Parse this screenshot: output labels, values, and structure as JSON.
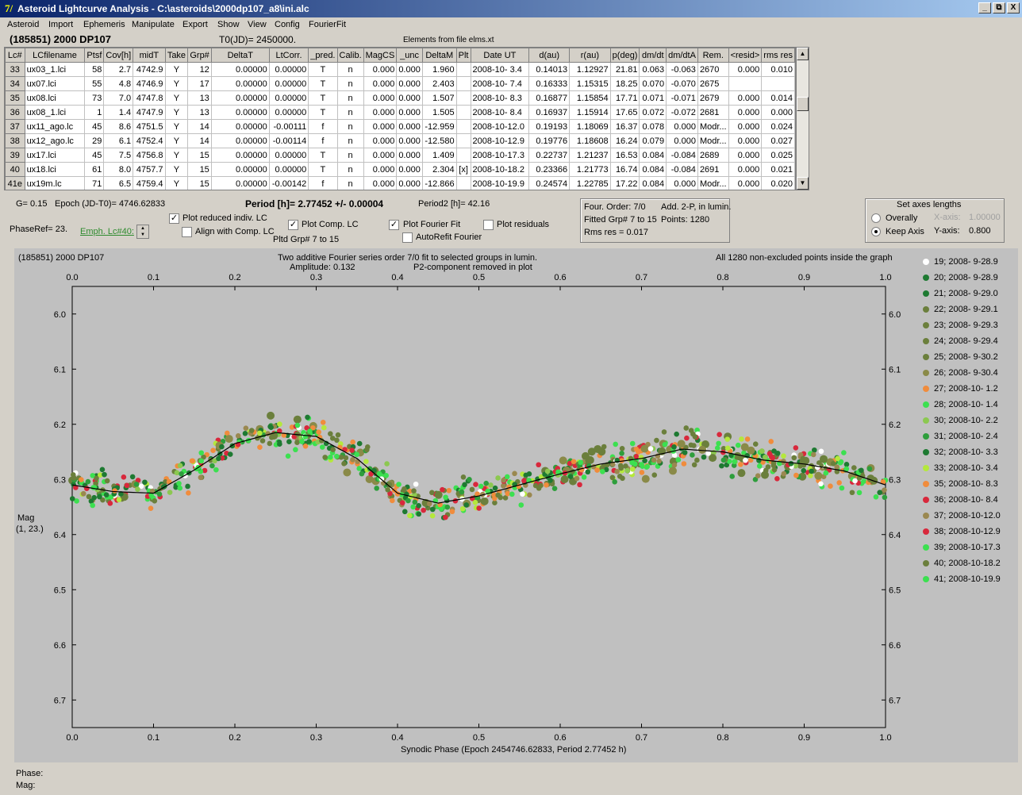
{
  "window": {
    "title": "Asteroid Lightcurve Analysis - C:\\asteroids\\2000dp107_a8\\ini.alc",
    "buttons": [
      "_",
      "⧉",
      "X"
    ]
  },
  "menu": [
    "Asteroid",
    "Import",
    "Ephemeris",
    "Manipulate",
    "Export",
    "Show",
    "View",
    "Config",
    "FourierFit"
  ],
  "header": {
    "object": "(185851) 2000 DP107",
    "t0": "T0(JD)= 2450000.",
    "elements": "Elements from file elms.xt"
  },
  "grid": {
    "columns": [
      "Lc#",
      "LCfilename",
      "Ptsf",
      "Cov[h]",
      "midT",
      "Take",
      "Grp#",
      "DeltaT",
      "LtCorr.",
      "_pred.",
      "Calib.",
      "MagCS",
      "_unc",
      "DeltaM",
      "Plt",
      "Date UT",
      "d(au)",
      "r(au)",
      "p(deg)",
      "dm/dt",
      "dm/dtA",
      "Rem.",
      "<resid>",
      "rms res"
    ],
    "rows": [
      [
        "33",
        "ux03_1.lci",
        "58",
        "2.7",
        "4742.9",
        "Y",
        "12",
        "0.00000",
        "0.00000",
        "T",
        "n",
        "0.000",
        "0.000",
        "1.960",
        "",
        "2008-10- 3.4",
        "0.14013",
        "1.12927",
        "21.81",
        "0.063",
        "-0.063",
        "2670",
        "0.000",
        "0.010"
      ],
      [
        "34",
        "ux07.lci",
        "55",
        "4.8",
        "4746.9",
        "Y",
        "17",
        "0.00000",
        "0.00000",
        "T",
        "n",
        "0.000",
        "0.000",
        "2.403",
        "",
        "2008-10- 7.4",
        "0.16333",
        "1.15315",
        "18.25",
        "0.070",
        "-0.070",
        "2675",
        "",
        ""
      ],
      [
        "35",
        "ux08.lci",
        "73",
        "7.0",
        "4747.8",
        "Y",
        "13",
        "0.00000",
        "0.00000",
        "T",
        "n",
        "0.000",
        "0.000",
        "1.507",
        "",
        "2008-10- 8.3",
        "0.16877",
        "1.15854",
        "17.71",
        "0.071",
        "-0.071",
        "2679",
        "0.000",
        "0.014"
      ],
      [
        "36",
        "ux08_1.lci",
        "1",
        "1.4",
        "4747.9",
        "Y",
        "13",
        "0.00000",
        "0.00000",
        "T",
        "n",
        "0.000",
        "0.000",
        "1.505",
        "",
        "2008-10- 8.4",
        "0.16937",
        "1.15914",
        "17.65",
        "0.072",
        "-0.072",
        "2681",
        "0.000",
        "0.000"
      ],
      [
        "37",
        "ux11_ago.lc",
        "45",
        "8.6",
        "4751.5",
        "Y",
        "14",
        "0.00000",
        "-0.00111",
        "f",
        "n",
        "0.000",
        "0.000",
        "-12.959",
        "",
        "2008-10-12.0",
        "0.19193",
        "1.18069",
        "16.37",
        "0.078",
        "0.000",
        "Modr...",
        "0.000",
        "0.024"
      ],
      [
        "38",
        "ux12_ago.lc",
        "29",
        "6.1",
        "4752.4",
        "Y",
        "14",
        "0.00000",
        "-0.00114",
        "f",
        "n",
        "0.000",
        "0.000",
        "-12.580",
        "",
        "2008-10-12.9",
        "0.19776",
        "1.18608",
        "16.24",
        "0.079",
        "0.000",
        "Modr...",
        "0.000",
        "0.027"
      ],
      [
        "39",
        "ux17.lci",
        "45",
        "7.5",
        "4756.8",
        "Y",
        "15",
        "0.00000",
        "0.00000",
        "T",
        "n",
        "0.000",
        "0.000",
        "1.409",
        "",
        "2008-10-17.3",
        "0.22737",
        "1.21237",
        "16.53",
        "0.084",
        "-0.084",
        "2689",
        "0.000",
        "0.025"
      ],
      [
        "40",
        "ux18.lci",
        "61",
        "8.0",
        "4757.7",
        "Y",
        "15",
        "0.00000",
        "0.00000",
        "T",
        "n",
        "0.000",
        "0.000",
        "2.304",
        "[x]",
        "2008-10-18.2",
        "0.23366",
        "1.21773",
        "16.74",
        "0.084",
        "-0.084",
        "2691",
        "0.000",
        "0.021"
      ],
      [
        "41e",
        "ux19m.lc",
        "71",
        "6.5",
        "4759.4",
        "Y",
        "15",
        "0.00000",
        "-0.00142",
        "f",
        "n",
        "0.000",
        "0.000",
        "-12.866",
        "",
        "2008-10-19.9",
        "0.24574",
        "1.22785",
        "17.22",
        "0.084",
        "0.000",
        "Modr...",
        "0.000",
        "0.020"
      ]
    ]
  },
  "controls": {
    "g": "G= 0.15",
    "epoch": "Epoch (JD-T0)= 4746.62833",
    "period": "Period [h]= 2.77452 +/- 0.00004",
    "period2": "Period2 [h]= 42.16",
    "phaseref": "PhaseRef= 23.",
    "emph": "Emph. Lc#40:",
    "plot_reduced": "Plot reduced indiv. LC",
    "align_comp": "Align with Comp. LC",
    "plot_comp": "Plot Comp. LC",
    "pltd_grp": "Pltd Grp#  7  to  15",
    "plot_fourier": "Plot Fourier Fit",
    "autorefit": "AutoRefit Fourier",
    "plot_resid": "Plot residuals",
    "four_order": "Four. Order:  7/0",
    "add2p": "Add. 2-P, in lumin.",
    "fitted": "Fitted Grp# 7 to 15",
    "points": "Points: 1280",
    "rms": "Rms res     = 0.017",
    "axes_title": "Set axes lengths",
    "overally": "Overally",
    "keep_axis": "Keep Axis",
    "xaxis_lbl": "X-axis:",
    "xaxis_val": "1.00000",
    "yaxis_lbl": "Y-axis:",
    "yaxis_val": "0.800"
  },
  "plot": {
    "object": "(185851) 2000 DP107",
    "caption1": "Two additive Fourier series order 7/0 fit to selected groups in lumin.",
    "caption2a": "Amplitude: 0.132",
    "caption2b": "P2-component removed in plot",
    "caption3": "All 1280 non-excluded points inside the graph",
    "ylabel1": "Mag",
    "ylabel2": "(1, 23.)",
    "xlabel": "Synodic Phase (Epoch 2454746.62833, Period 2.77452 h)",
    "phase_lbl": "Phase:",
    "mag_lbl": "Mag:"
  },
  "chart_data": {
    "type": "scatter",
    "xlabel": "Synodic Phase (Epoch 2454746.62833, Period 2.77452 h)",
    "ylabel": "Mag",
    "xlim": [
      0.0,
      1.0
    ],
    "ylim": [
      6.75,
      5.95
    ],
    "x_ticks": [
      "0.0",
      "0.1",
      "0.2",
      "0.3",
      "0.4",
      "0.5",
      "0.6",
      "0.7",
      "0.8",
      "0.9",
      "1.0"
    ],
    "y_ticks": [
      "6.0",
      "6.1",
      "6.2",
      "6.3",
      "6.4",
      "6.5",
      "6.6",
      "6.7"
    ],
    "fourier_fit": {
      "x": [
        0.0,
        0.05,
        0.1,
        0.15,
        0.2,
        0.25,
        0.3,
        0.35,
        0.4,
        0.45,
        0.5,
        0.55,
        0.6,
        0.65,
        0.7,
        0.75,
        0.8,
        0.85,
        0.9,
        0.95,
        1.0
      ],
      "y": [
        6.31,
        6.322,
        6.325,
        6.283,
        6.235,
        6.215,
        6.222,
        6.262,
        6.325,
        6.343,
        6.33,
        6.31,
        6.29,
        6.272,
        6.262,
        6.245,
        6.25,
        6.265,
        6.272,
        6.285,
        6.31
      ]
    },
    "series": [
      {
        "name": "19; 2008- 9-28.9",
        "color": "#ffffff"
      },
      {
        "name": "20; 2008- 9-28.9",
        "color": "#1e7a32"
      },
      {
        "name": "21; 2008- 9-29.0",
        "color": "#1e7a32"
      },
      {
        "name": "22; 2008- 9-29.1",
        "color": "#6b7f3c"
      },
      {
        "name": "23; 2008- 9-29.3",
        "color": "#6b7f3c"
      },
      {
        "name": "24; 2008- 9-29.4",
        "color": "#6b7f3c"
      },
      {
        "name": "25; 2008- 9-30.2",
        "color": "#6b7f3c"
      },
      {
        "name": "26; 2008- 9-30.4",
        "color": "#8a8a48"
      },
      {
        "name": "27; 2008-10- 1.2",
        "color": "#f08c3c"
      },
      {
        "name": "28; 2008-10- 1.4",
        "color": "#3ce050"
      },
      {
        "name": "30; 2008-10- 2.2",
        "color": "#8cc850"
      },
      {
        "name": "31; 2008-10- 2.4",
        "color": "#2e9e3c"
      },
      {
        "name": "32; 2008-10- 3.3",
        "color": "#1e7a32"
      },
      {
        "name": "33; 2008-10- 3.4",
        "color": "#b4e83c"
      },
      {
        "name": "35; 2008-10- 8.3",
        "color": "#f08c3c"
      },
      {
        "name": "36; 2008-10- 8.4",
        "color": "#d8283c"
      },
      {
        "name": "37; 2008-10-12.0",
        "color": "#9a8850"
      },
      {
        "name": "38; 2008-10-12.9",
        "color": "#d8283c"
      },
      {
        "name": "39; 2008-10-17.3",
        "color": "#3ce050"
      },
      {
        "name": "40; 2008-10-18.2",
        "color": "#6b7f3c"
      },
      {
        "name": "41; 2008-10-19.9",
        "color": "#3ce050"
      }
    ]
  }
}
